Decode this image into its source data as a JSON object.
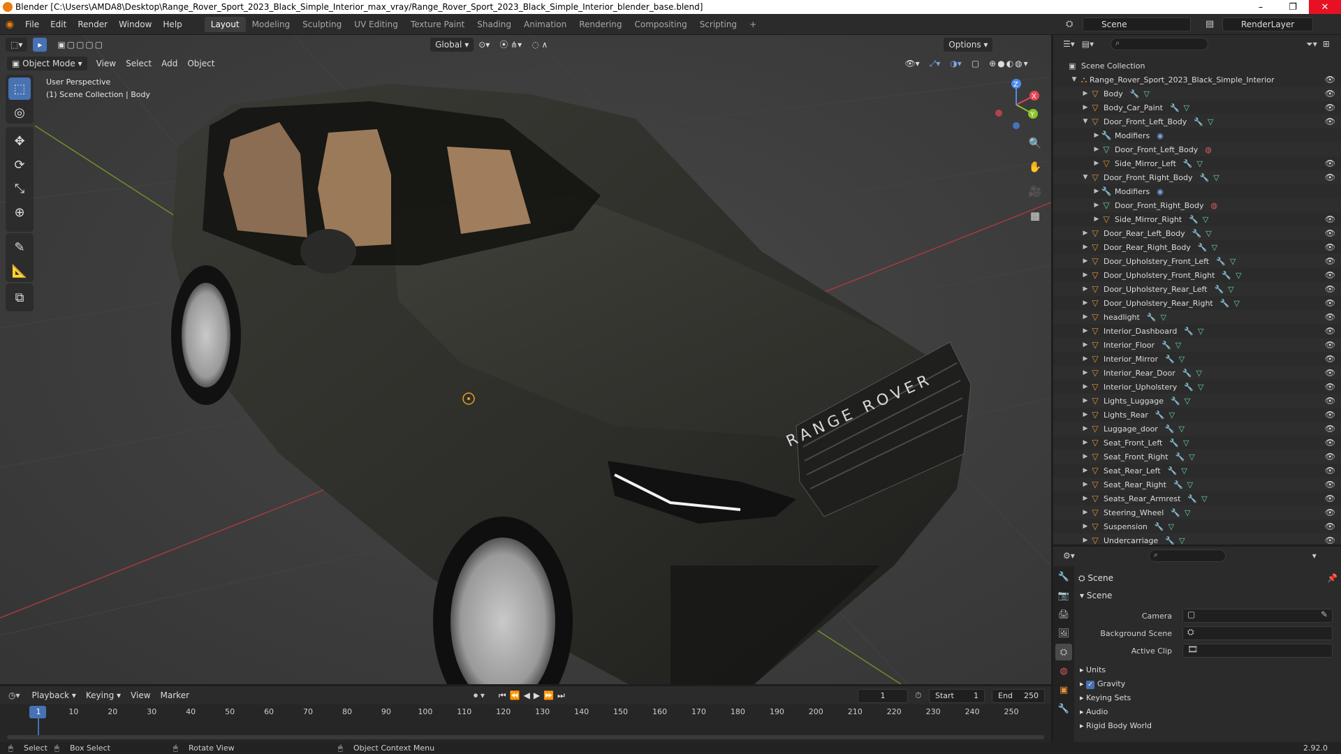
{
  "window": {
    "title": "Blender [C:\\Users\\AMDA8\\Desktop\\Range_Rover_Sport_2023_Black_Simple_Interior_max_vray/Range_Rover_Sport_2023_Black_Simple_Interior_blender_base.blend]",
    "controls": [
      "–",
      "❐",
      "✕"
    ]
  },
  "menu": [
    "File",
    "Edit",
    "Render",
    "Window",
    "Help"
  ],
  "workspaces": [
    {
      "label": "Layout",
      "active": true
    },
    {
      "label": "Modeling"
    },
    {
      "label": "Sculpting"
    },
    {
      "label": "UV Editing"
    },
    {
      "label": "Texture Paint"
    },
    {
      "label": "Shading"
    },
    {
      "label": "Animation"
    },
    {
      "label": "Rendering"
    },
    {
      "label": "Compositing"
    },
    {
      "label": "Scripting"
    }
  ],
  "scene_selector": "Scene",
  "render_layer": "RenderLayer",
  "viewport": {
    "transform": "Global",
    "options": "Options",
    "mode": "Object Mode",
    "header_menus": [
      "View",
      "Select",
      "Add",
      "Object"
    ],
    "overlay_title": "User Perspective",
    "overlay_sub": "(1) Scene Collection | Body",
    "brand_text": "RANGE ROVER",
    "gizmo": {
      "x": "X",
      "y": "Y",
      "z": "Z"
    }
  },
  "outliner": {
    "root": "Scene Collection",
    "collection": "Range_Rover_Sport_2023_Black_Simple_Interior",
    "items": [
      {
        "label": "Body",
        "depth": 0
      },
      {
        "label": "Body_Car_Paint",
        "depth": 0
      },
      {
        "label": "Door_Front_Left_Body",
        "depth": 0,
        "open": true
      },
      {
        "label": "Modifiers",
        "depth": 1
      },
      {
        "label": "Door_Front_Left_Body",
        "depth": 1
      },
      {
        "label": "Side_Mirror_Left",
        "depth": 1
      },
      {
        "label": "Door_Front_Right_Body",
        "depth": 0,
        "open": true
      },
      {
        "label": "Modifiers",
        "depth": 1
      },
      {
        "label": "Door_Front_Right_Body",
        "depth": 1
      },
      {
        "label": "Side_Mirror_Right",
        "depth": 1
      },
      {
        "label": "Door_Rear_Left_Body",
        "depth": 0
      },
      {
        "label": "Door_Rear_Right_Body",
        "depth": 0
      },
      {
        "label": "Door_Upholstery_Front_Left",
        "depth": 0
      },
      {
        "label": "Door_Upholstery_Front_Right",
        "depth": 0
      },
      {
        "label": "Door_Upholstery_Rear_Left",
        "depth": 0
      },
      {
        "label": "Door_Upholstery_Rear_Right",
        "depth": 0
      },
      {
        "label": "headlight",
        "depth": 0
      },
      {
        "label": "Interior_Dashboard",
        "depth": 0
      },
      {
        "label": "Interior_Floor",
        "depth": 0
      },
      {
        "label": "Interior_Mirror",
        "depth": 0
      },
      {
        "label": "Interior_Rear_Door",
        "depth": 0
      },
      {
        "label": "Interior_Upholstery",
        "depth": 0
      },
      {
        "label": "Lights_Luggage",
        "depth": 0
      },
      {
        "label": "Lights_Rear",
        "depth": 0
      },
      {
        "label": "Luggage_door",
        "depth": 0
      },
      {
        "label": "Seat_Front_Left",
        "depth": 0
      },
      {
        "label": "Seat_Front_Right",
        "depth": 0
      },
      {
        "label": "Seat_Rear_Left",
        "depth": 0
      },
      {
        "label": "Seat_Rear_Right",
        "depth": 0
      },
      {
        "label": "Seats_Rear_Armrest",
        "depth": 0
      },
      {
        "label": "Steering_Wheel",
        "depth": 0
      },
      {
        "label": "Suspension",
        "depth": 0
      },
      {
        "label": "Undercarriage",
        "depth": 0
      }
    ]
  },
  "properties": {
    "context": "Scene",
    "section": "Scene",
    "fields": [
      {
        "label": "Camera"
      },
      {
        "label": "Background Scene"
      },
      {
        "label": "Active Clip"
      }
    ],
    "panels": [
      {
        "label": "Units"
      },
      {
        "label": "Gravity",
        "checked": true
      },
      {
        "label": "Keying Sets"
      },
      {
        "label": "Audio"
      },
      {
        "label": "Rigid Body World"
      }
    ]
  },
  "timeline": {
    "menus": [
      "Playback",
      "Keying",
      "View",
      "Marker"
    ],
    "current_frame": "1",
    "start_label": "Start",
    "start": "1",
    "end_label": "End",
    "end": "250",
    "ticks": [
      "1",
      "10",
      "20",
      "30",
      "40",
      "50",
      "60",
      "70",
      "80",
      "90",
      "100",
      "110",
      "120",
      "130",
      "140",
      "150",
      "160",
      "170",
      "180",
      "190",
      "200",
      "210",
      "220",
      "230",
      "240",
      "250"
    ]
  },
  "status": {
    "select": "Select",
    "box_select": "Box Select",
    "rotate_view": "Rotate View",
    "context_menu": "Object Context Menu",
    "version": "2.92.0"
  },
  "colors": {
    "accent": "#4772b3",
    "object_icon": "#e5933b",
    "mesh_icon": "#66d6b0",
    "modifier_icon": "#7ea3e6",
    "axis_x": "#e84654",
    "axis_y": "#8bc42b",
    "axis_z": "#4d8cf0"
  }
}
